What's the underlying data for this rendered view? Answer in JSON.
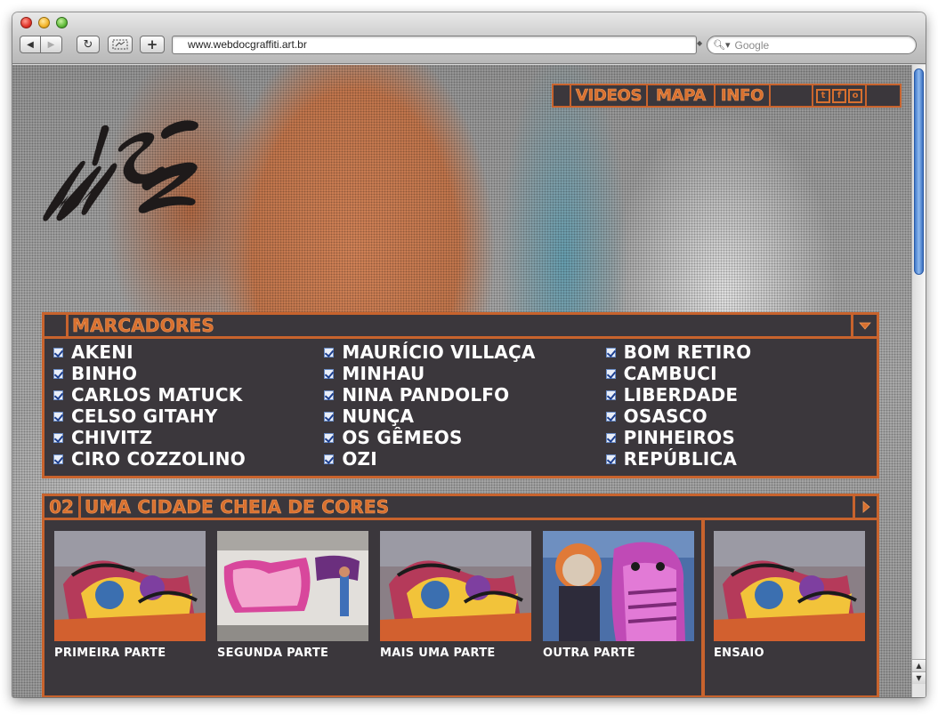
{
  "browser": {
    "url": "www.webdocgraffiti.art.br",
    "search_placeholder": "Google",
    "buttons": {
      "back": "◀",
      "forward": "▶",
      "reload": "↻",
      "add": "+"
    }
  },
  "nav": {
    "links": [
      "VIDEOS",
      "MAPA",
      "INFO"
    ],
    "social_icons": [
      "twitter-icon",
      "facebook-icon",
      "instagram-icon"
    ],
    "social_glyphs": [
      "t",
      "f",
      "o"
    ]
  },
  "marcadores": {
    "title": "MARCADORES",
    "columns": [
      [
        "AKENI",
        "BINHO",
        "CARLOS MATUCK",
        "CELSO GITAHY",
        "CHIVITZ",
        "CIRO COZZOLINO"
      ],
      [
        "MAURÍCIO VILLAÇA",
        "MINHAU",
        "NINA PANDOLFO",
        "NUNÇA",
        "OS GÊMEOS",
        "OZI"
      ],
      [
        "BOM RETIRO",
        "CAMBUCI",
        "LIBERDADE",
        "OSASCO",
        "PINHEIROS",
        "REPÚBLICA"
      ]
    ],
    "all_checked": true
  },
  "videos": {
    "number": "02",
    "title": "UMA CIDADE CHEIA DE CORES",
    "parts": [
      "PRIMEIRA PARTE",
      "SEGUNDA PARTE",
      "MAIS UMA PARTE",
      "OUTRA PARTE"
    ],
    "extra": "ENSAIO"
  },
  "colors": {
    "accent": "#c8632d",
    "panel": "#3b373c",
    "text": "#ffffff"
  }
}
